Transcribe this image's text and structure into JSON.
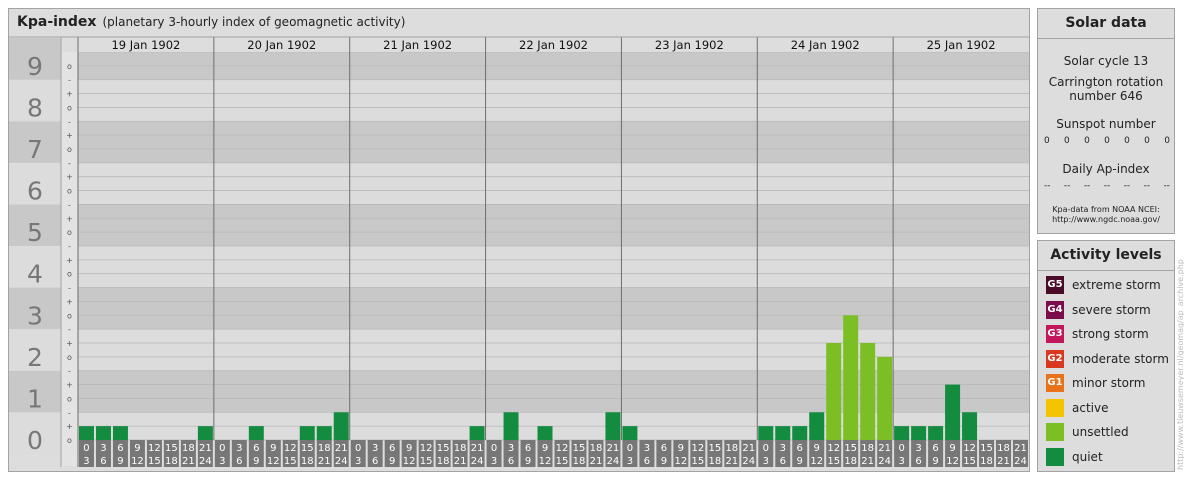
{
  "header": {
    "title": "Kpa-index",
    "subtitle": "(planetary 3-hourly index of geomagnetic activity)"
  },
  "chart_data": {
    "type": "bar",
    "title": "Kpa-index",
    "subtitle": "(planetary 3-hourly index of geomagnetic activity)",
    "ylim": [
      0,
      9
    ],
    "y_ticks": [
      "0",
      "1",
      "2",
      "3",
      "4",
      "5",
      "6",
      "7",
      "8",
      "9"
    ],
    "minor_ticks": [
      "o",
      "+",
      "-"
    ],
    "hour_start_labels": [
      "0",
      "3",
      "6",
      "9",
      "12",
      "15",
      "18",
      "21"
    ],
    "hour_end_labels": [
      "3",
      "6",
      "9",
      "12",
      "15",
      "18",
      "21",
      "24"
    ],
    "grid": true,
    "days": [
      {
        "date": "19 Jan 1902",
        "values": [
          0.333,
          0.333,
          0.333,
          0,
          0,
          0,
          0,
          0.333
        ]
      },
      {
        "date": "20 Jan 1902",
        "values": [
          0,
          0,
          0.333,
          0,
          0,
          0.333,
          0.333,
          0.667
        ]
      },
      {
        "date": "21 Jan 1902",
        "values": [
          0,
          0,
          0,
          0,
          0,
          0,
          0,
          0.333
        ]
      },
      {
        "date": "22 Jan 1902",
        "values": [
          0,
          0.667,
          0,
          0.333,
          0,
          0,
          0,
          0.667
        ]
      },
      {
        "date": "23 Jan 1902",
        "values": [
          0.333,
          0,
          0,
          0,
          0,
          0,
          0,
          0
        ]
      },
      {
        "date": "24 Jan 1902",
        "values": [
          0.333,
          0.333,
          0.333,
          0.667,
          2.333,
          3.0,
          2.333,
          2.0
        ]
      },
      {
        "date": "25 Jan 1902",
        "values": [
          0.333,
          0.333,
          0.333,
          1.333,
          0.667,
          0,
          0,
          0
        ]
      }
    ],
    "level_colors": {
      "quiet": "#138c3f",
      "unsettled": "#7bbf24"
    }
  },
  "solar": {
    "title": "Solar data",
    "cycle": "Solar cycle 13",
    "carrington_1": "Carrington rotation",
    "carrington_2": "number 646",
    "sunspot_title": "Sunspot number",
    "sunspot_values": [
      "0",
      "0",
      "0",
      "0",
      "0",
      "0",
      "0"
    ],
    "ap_title": "Daily Ap-index",
    "ap_values": [
      "--",
      "--",
      "--",
      "--",
      "--",
      "--",
      "--"
    ],
    "credit_1": "Kpa-data from NOAA NCEI:",
    "credit_2": "http://www.ngdc.noaa.gov/"
  },
  "levels": {
    "title": "Activity levels",
    "items": [
      {
        "code": "G5",
        "label": "extreme storm",
        "color": "#4a0a2a"
      },
      {
        "code": "G4",
        "label": "severe storm",
        "color": "#7a0d4a"
      },
      {
        "code": "G3",
        "label": "strong storm",
        "color": "#c2185b"
      },
      {
        "code": "G2",
        "label": "moderate storm",
        "color": "#d9381e"
      },
      {
        "code": "G1",
        "label": "minor storm",
        "color": "#e8731a"
      },
      {
        "code": "",
        "label": "active",
        "color": "#f5c400"
      },
      {
        "code": "",
        "label": "unsettled",
        "color": "#7bbf24"
      },
      {
        "code": "",
        "label": "quiet",
        "color": "#138c3f"
      }
    ]
  },
  "watermark": "http://www.tieuwsemeyer.nl/geomag/ap_archive.php"
}
